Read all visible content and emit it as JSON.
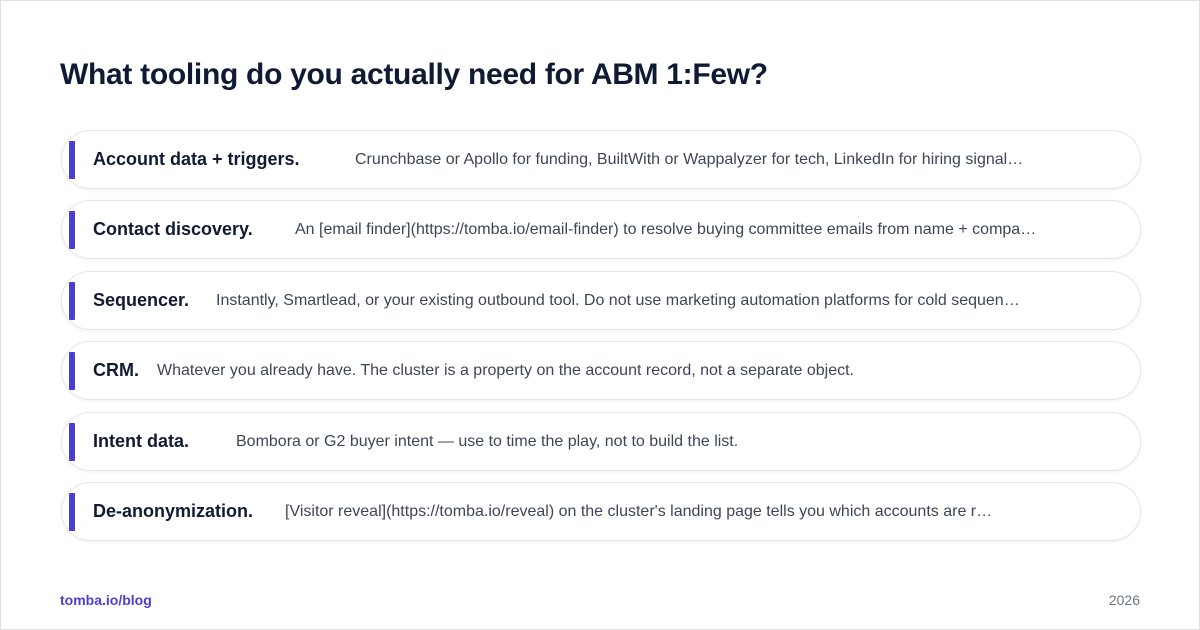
{
  "title": "What tooling do you actually need for ABM 1:Few?",
  "items": [
    {
      "label": "Account data + triggers.",
      "text": "Crunchbase or Apollo for funding, BuiltWith or Wappalyzer for tech, LinkedIn for hiring signal…"
    },
    {
      "label": "Contact discovery.",
      "text": "An [email finder](https://tomba.io/email-finder) to resolve buying committee emails from name + compa…"
    },
    {
      "label": "Sequencer.",
      "text": "Instantly, Smartlead, or your existing outbound tool. Do not use marketing automation platforms for cold sequen…"
    },
    {
      "label": "CRM.",
      "text": "Whatever you already have. The cluster is a property on the account record, not a separate object."
    },
    {
      "label": "Intent data.",
      "text": "Bombora or G2 buyer intent — use to time the play, not to build the list."
    },
    {
      "label": "De-anonymization.",
      "text": "[Visitor reveal](https://tomba.io/reveal) on the cluster's landing page tells you which accounts are r…"
    }
  ],
  "footer": {
    "source": "tomba.io/blog",
    "year": "2026"
  },
  "colors": {
    "accent": "#4a3fd1",
    "heading": "#0f1a33",
    "body_text": "#3d4656",
    "muted": "#6b7280",
    "card_border": "#e3e6ec"
  }
}
